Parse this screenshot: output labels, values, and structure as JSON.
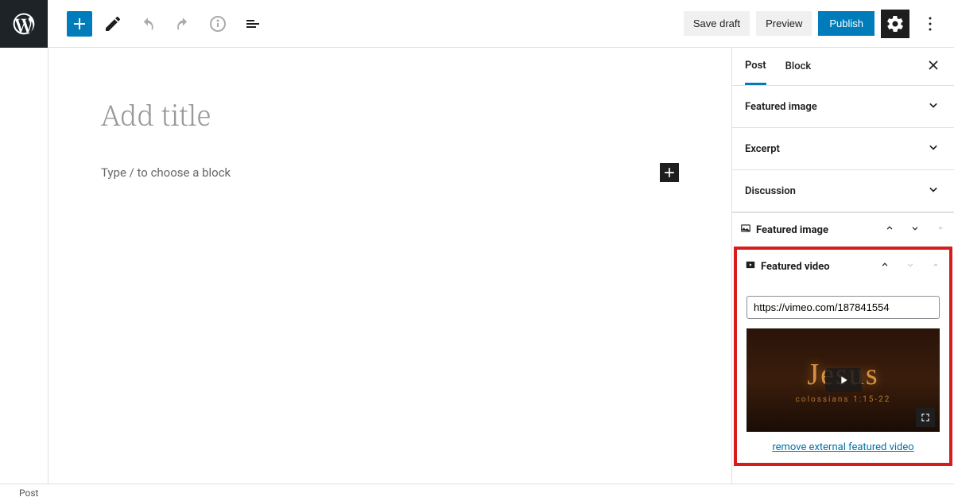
{
  "toolbar": {
    "save_draft": "Save draft",
    "preview": "Preview",
    "publish": "Publish"
  },
  "editor": {
    "title_placeholder": "Add title",
    "block_placeholder": "Type / to choose a block"
  },
  "sidebar": {
    "tabs": {
      "post": "Post",
      "block": "Block"
    },
    "panels": {
      "featured_image": "Featured image",
      "excerpt": "Excerpt",
      "discussion": "Discussion"
    },
    "meta": {
      "featured_image_label": "Featured image",
      "featured_video_label": "Featured video",
      "video_url": "https://vimeo.com/187841554",
      "video_title": "Jesus",
      "video_subtitle": "colossians 1:15-22",
      "remove_link": "remove external featured video"
    }
  },
  "footer": {
    "breadcrumb": "Post"
  }
}
